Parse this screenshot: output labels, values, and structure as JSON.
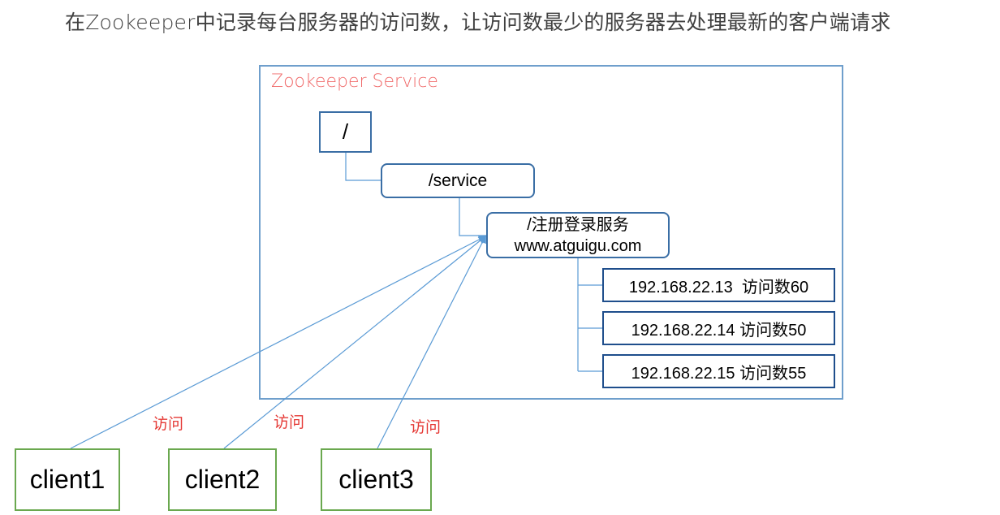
{
  "caption": "在Zookeeper中记录每台服务器的访问数，让访问数最少的服务器去处理最新的客户端请求",
  "service": {
    "label": "Zookeeper Service"
  },
  "nodes": {
    "root": "/",
    "service": "/service",
    "register_line1": "/注册登录服务",
    "register_line2": "www.atguigu.com"
  },
  "servers": [
    {
      "text": "192.168.22.13  访问数60"
    },
    {
      "text": "192.168.22.14 访问数50"
    },
    {
      "text": "192.168.22.15 访问数55"
    }
  ],
  "clients": [
    {
      "label": "client1"
    },
    {
      "label": "client2"
    },
    {
      "label": "client3"
    }
  ],
  "access_labels": [
    "访问",
    "访问",
    "访问"
  ],
  "colors": {
    "frame": "#6f9fcc",
    "service_label": "#f06a6a",
    "node_border": "#3a6ea5",
    "client_border": "#6aa84f",
    "access_text": "#e53935",
    "connector": "#5b9bd5"
  }
}
